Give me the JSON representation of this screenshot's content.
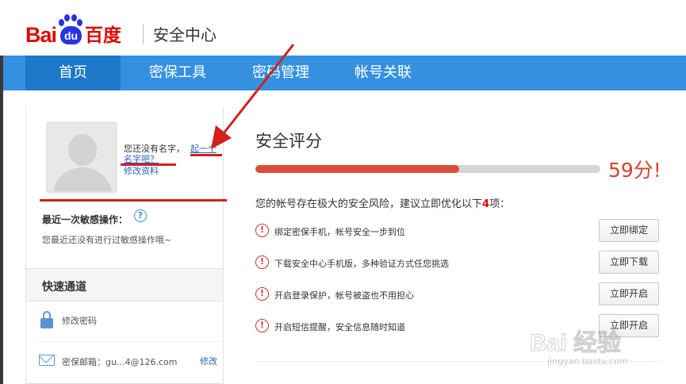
{
  "brand": {
    "logo_bai": "Bai",
    "logo_du": "du",
    "logo_cn": "百度",
    "section_title": "安全中心",
    "colors": {
      "red": "#e10601",
      "blue": "#2932e1"
    }
  },
  "nav": {
    "items": [
      {
        "label": "首页",
        "active": true
      },
      {
        "label": "密保工具",
        "active": false
      },
      {
        "label": "密码管理",
        "active": false
      },
      {
        "label": "帐号关联",
        "active": false
      }
    ],
    "colors": {
      "bar": "#3591e0",
      "active": "#1e78c9"
    }
  },
  "profile": {
    "no_name_text": "您还没有名字，",
    "name_link_part1": "起一个",
    "name_link_part2": "名字吧？",
    "edit_profile": "修改资料",
    "avatar_icon": "default-avatar-icon"
  },
  "recent": {
    "title": "最近一次敏感操作：",
    "help_icon": "?",
    "description": "您最近还没有进行过敏感操作哦~"
  },
  "quick_access": {
    "title": "快速通道",
    "change_password": "修改密码",
    "email_label": "密保邮箱：gu...4@126.com",
    "email_edit": "修改"
  },
  "security": {
    "title": "安全评分",
    "score_text": "59分!",
    "score_fraction": 0.59,
    "risk_summary_prefix": "您的帐号存在极大的安全风险，建议立即优化以下",
    "risk_count": "4",
    "risk_summary_suffix": "项：",
    "warn_icon": "!",
    "tasks": [
      {
        "text": "绑定密保手机，帐号安全一步到位",
        "button": "立即绑定"
      },
      {
        "text": "下载安全中心手机版，多种验证方式任您挑选",
        "button": "立即下载"
      },
      {
        "text": "开启登录保护，帐号被盗也不用担心",
        "button": "立即开启"
      },
      {
        "text": "开启短信提醒，安全信息随时知道",
        "button": "立即开启"
      }
    ],
    "colors": {
      "fill": "#dd4c3a",
      "track": "#d6d6d6",
      "score": "#d6422f"
    }
  },
  "watermark": {
    "text": "Bai  经验",
    "url": "jingyan.baidu.com"
  }
}
